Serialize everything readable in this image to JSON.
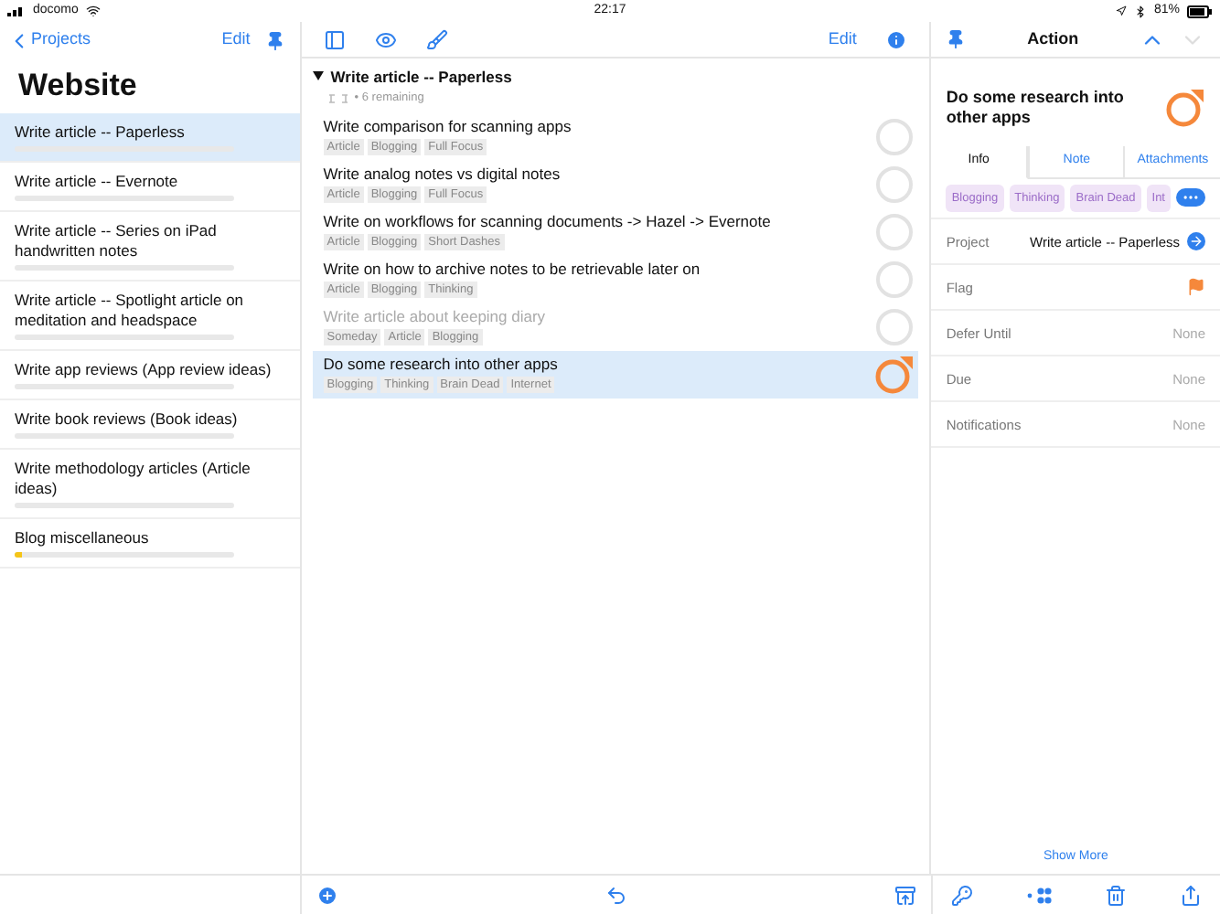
{
  "status_bar": {
    "carrier": "docomo",
    "time": "22:17",
    "battery": "81%"
  },
  "sidebar": {
    "back": "Projects",
    "edit": "Edit",
    "title": "Website",
    "items": [
      {
        "label": "Write article -- Paperless",
        "selected": true,
        "level": 0
      },
      {
        "label": "Write article -- Evernote",
        "selected": false,
        "level": 0
      },
      {
        "label": "Write article -- Series on iPad handwritten notes",
        "selected": false,
        "level": 0
      },
      {
        "label": "Write article -- Spotlight article on meditation and headspace",
        "selected": false,
        "level": 0
      },
      {
        "label": "Write app reviews (App review ideas)",
        "selected": false,
        "level": 0
      },
      {
        "label": "Write book reviews (Book ideas)",
        "selected": false,
        "level": 0
      },
      {
        "label": "Write methodology articles (Article ideas)",
        "selected": false,
        "level": 0
      },
      {
        "label": "Blog miscellaneous",
        "selected": false,
        "level": 0.03
      }
    ]
  },
  "outline": {
    "edit": "Edit",
    "project": {
      "title": "Write article -- Paperless",
      "expanded": true,
      "remaining": "• 6 remaining"
    },
    "tasks": [
      {
        "title": "Write comparison for scanning apps",
        "tags": [
          "Article",
          "Blogging",
          "Full Focus"
        ],
        "disabled": false,
        "selected": false,
        "flagged": false
      },
      {
        "title": "Write analog notes vs digital notes",
        "tags": [
          "Article",
          "Blogging",
          "Full Focus"
        ],
        "disabled": false,
        "selected": false,
        "flagged": false
      },
      {
        "title": "Write on workflows for scanning documents -> Hazel -> Evernote",
        "tags": [
          "Article",
          "Blogging",
          "Short Dashes"
        ],
        "disabled": false,
        "selected": false,
        "flagged": false
      },
      {
        "title": "Write on how to archive notes to be retrievable later on",
        "tags": [
          "Article",
          "Blogging",
          "Thinking"
        ],
        "disabled": false,
        "selected": false,
        "flagged": false
      },
      {
        "title": "Write article about keeping diary",
        "tags": [
          "Someday",
          "Article",
          "Blogging"
        ],
        "disabled": true,
        "selected": false,
        "flagged": false
      },
      {
        "title": "Do some research into other apps",
        "tags": [
          "Blogging",
          "Thinking",
          "Brain Dead",
          "Internet"
        ],
        "disabled": false,
        "selected": true,
        "flagged": true
      }
    ]
  },
  "inspector": {
    "header": "Action",
    "title": "Do some research into other apps",
    "flagged": true,
    "tabs": [
      {
        "label": "Info",
        "selected": true
      },
      {
        "label": "Note",
        "selected": false
      },
      {
        "label": "Attachments",
        "selected": false
      }
    ],
    "tags": [
      "Blogging",
      "Thinking",
      "Brain Dead",
      "Int"
    ],
    "fields": [
      {
        "kind": "project",
        "label": "Project",
        "value": "Write article -- Paperless"
      },
      {
        "kind": "flag",
        "label": "Flag",
        "on": true
      },
      {
        "kind": "text",
        "label": "Defer Until",
        "value": "None"
      },
      {
        "kind": "text",
        "label": "Due",
        "value": "None"
      },
      {
        "kind": "text",
        "label": "Notifications",
        "value": "None"
      }
    ],
    "show_more": "Show More"
  }
}
